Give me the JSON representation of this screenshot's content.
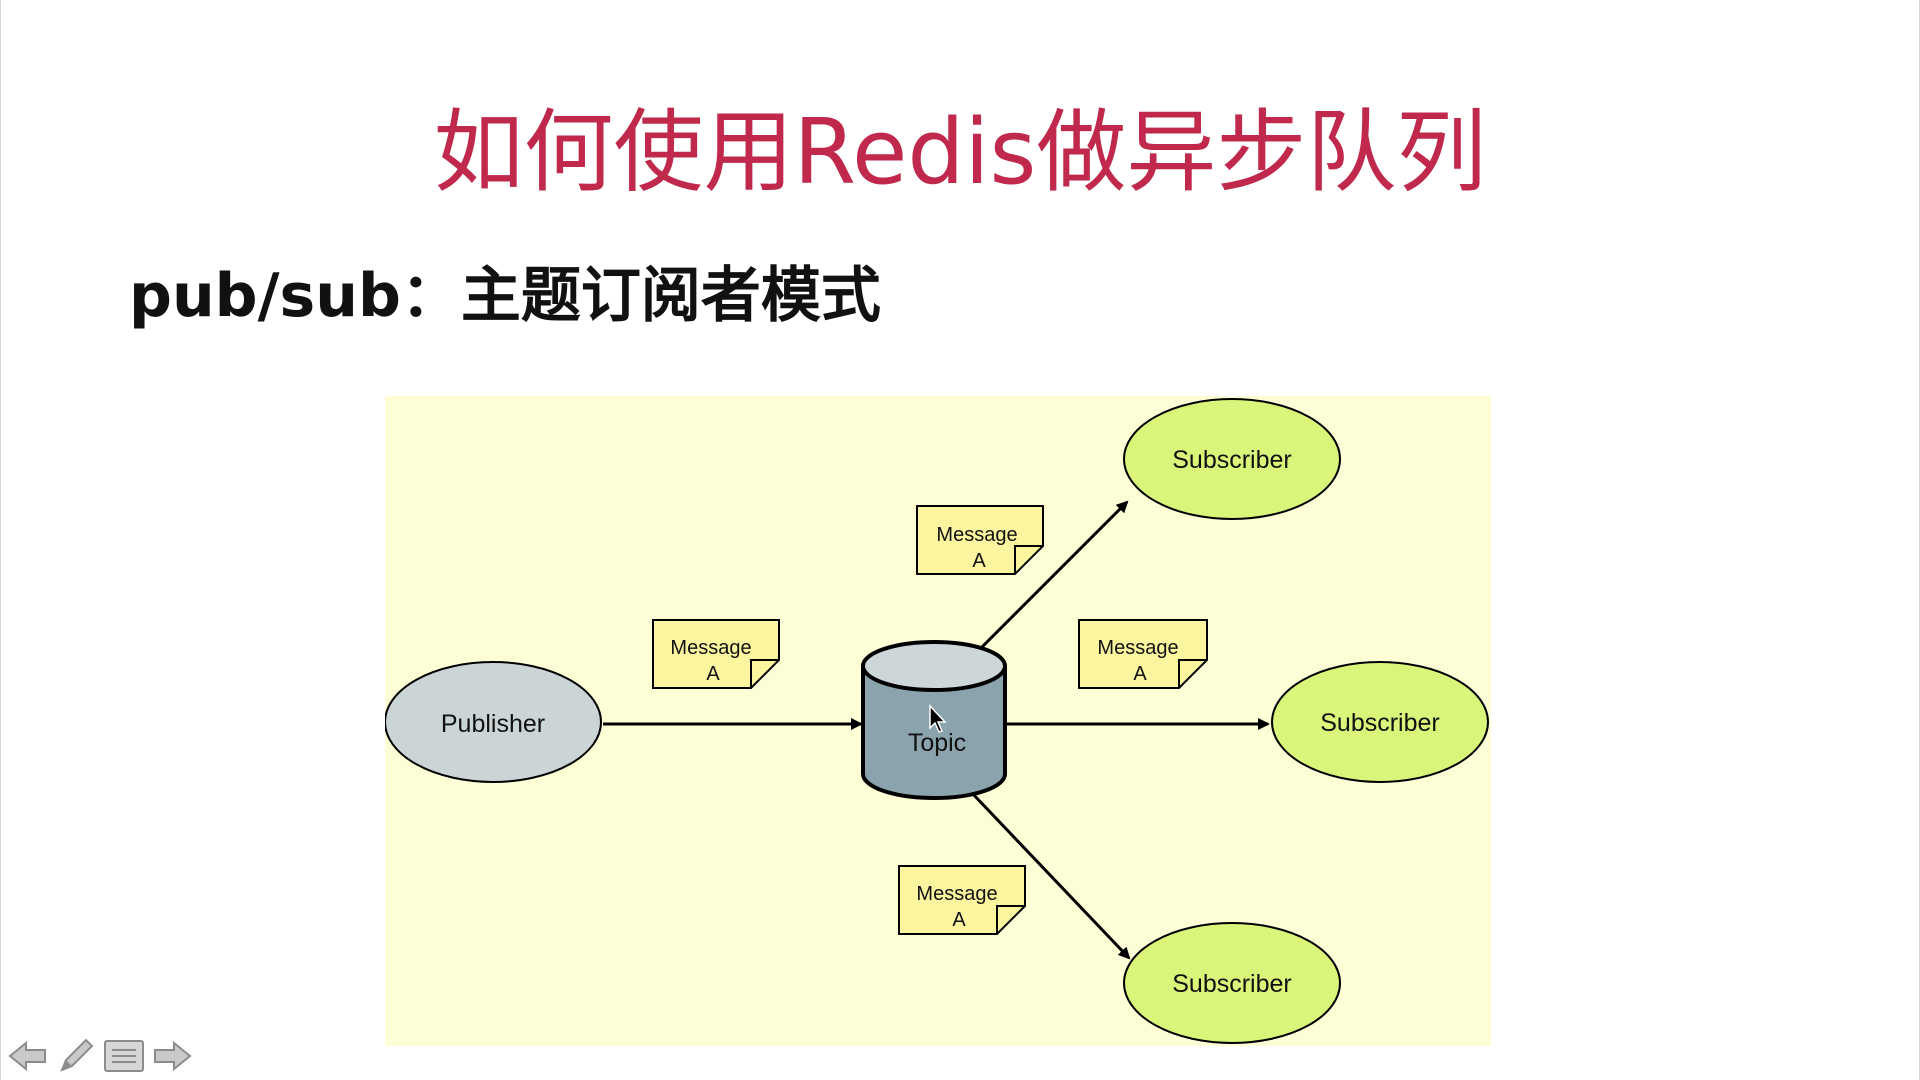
{
  "slide": {
    "title": "如何使用Redis做异步队列",
    "subtitle": "pub/sub：主题订阅者模式"
  },
  "diagram": {
    "publisher": "Publisher",
    "topic": "Topic",
    "subscribers": [
      "Subscriber",
      "Subscriber",
      "Subscriber"
    ],
    "message_line1": "Message",
    "message_line2": "A"
  },
  "colors": {
    "title": "#c0294b",
    "diagram_bg": "#fdfdd6",
    "publisher_fill": "#ccd5d6",
    "subscriber_fill": "#d9f57a",
    "topic_fill": "#8aa3ac",
    "note_fill": "#fbf5a0"
  },
  "toolbar": {
    "prev_icon": "arrow-left-icon",
    "pen_icon": "pen-icon",
    "menu_icon": "menu-icon",
    "next_icon": "arrow-right-icon"
  }
}
